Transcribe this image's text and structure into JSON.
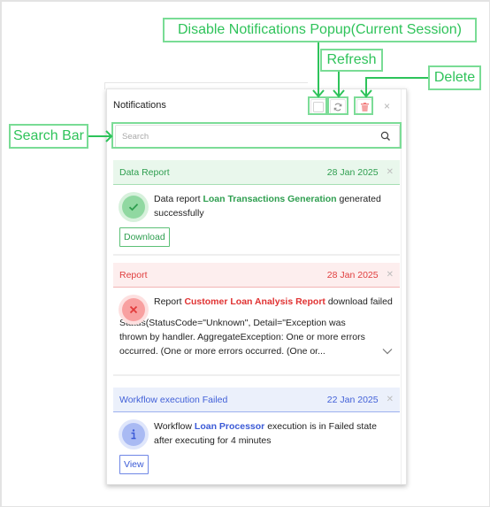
{
  "annotations": {
    "disable_popup": "Disable Notifications Popup(Current Session)",
    "refresh": "Refresh",
    "delete": "Delete",
    "search_bar": "Search Bar"
  },
  "panel": {
    "title": "Notifications",
    "close_icon": "×",
    "toolbar": {
      "disable_checkbox_icon": "checkbox-empty-icon",
      "refresh_icon": "refresh-icon",
      "delete_icon": "trash-icon"
    },
    "search": {
      "placeholder": "Search",
      "value": "",
      "icon": "search-icon"
    },
    "notifications": [
      {
        "type": "success",
        "category": "Data Report",
        "date": "28 Jan 2025",
        "icon": "check-icon",
        "message_prefix": "Data report ",
        "message_highlight": "Loan Transactions Generation",
        "message_suffix": " generated successfully",
        "action_label": "Download",
        "color": "#2e9e4f"
      },
      {
        "type": "error",
        "category": "Report",
        "date": "28 Jan 2025",
        "icon": "x-icon",
        "message_prefix": "Report ",
        "message_highlight": "Customer Loan Analysis Report",
        "message_suffix": " download failed",
        "detail": "Status(StatusCode=\"Unknown\", Detail=\"Exception was thrown by handler. AggregateException: One or more errors occurred. (One or more errors occurred. (One or...",
        "expand_icon": "chevron-down-icon",
        "color": "#e03e3e"
      },
      {
        "type": "info",
        "category": "Workflow execution Failed",
        "date": "22 Jan 2025",
        "icon": "info-icon",
        "message_prefix": "Workflow ",
        "message_highlight": "Loan Processor",
        "message_suffix": " execution is in Failed state after executing for 4 minutes",
        "action_label": "View",
        "color": "#4160d8"
      }
    ]
  }
}
